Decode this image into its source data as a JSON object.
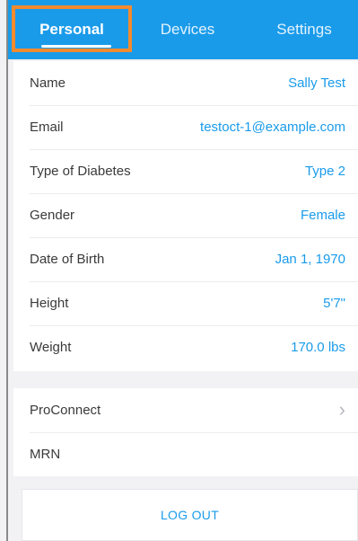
{
  "tabs": {
    "personal": "Personal",
    "devices": "Devices",
    "settings": "Settings"
  },
  "profile": {
    "rows": [
      {
        "label": "Name",
        "value": "Sally Test"
      },
      {
        "label": "Email",
        "value": "testoct-1@example.com"
      },
      {
        "label": "Type of Diabetes",
        "value": "Type 2"
      },
      {
        "label": "Gender",
        "value": "Female"
      },
      {
        "label": "Date of Birth",
        "value": "Jan 1, 1970"
      },
      {
        "label": "Height",
        "value": "5'7\""
      },
      {
        "label": "Weight",
        "value": "170.0 lbs"
      }
    ]
  },
  "extra": {
    "proconnect_label": "ProConnect",
    "chevron_icon": "chevron-right-icon",
    "mrn_label": "MRN"
  },
  "actions": {
    "logout_label": "LOG OUT"
  },
  "colors": {
    "accent": "#1a9bea",
    "highlight": "#f28a2e"
  }
}
